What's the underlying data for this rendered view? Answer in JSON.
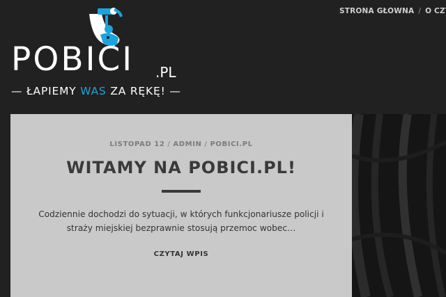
{
  "nav": {
    "items": [
      "STRONA GŁÓWNA",
      "O CZYM"
    ],
    "separator": "/"
  },
  "logo": {
    "word": "POBICI",
    "suffix": ".PL",
    "tagline_dash_left": "—",
    "tagline_pre": "ŁAPIEMY",
    "tagline_highlight": "WAS",
    "tagline_post": "ZA RĘKĘ!",
    "tagline_dash_right": "—",
    "accent_color": "#1aa3dd"
  },
  "post": {
    "date": "LISTOPAD 12",
    "author": "ADMIN",
    "category": "POBICI.PL",
    "meta_separator": "/",
    "title": "WITAMY NA POBICI.PL!",
    "excerpt": "Codziennie dochodzi do sytuacji, w których funkcjonariusze policji i straży miejskiej bezprawnie stosują przemoc wobec…",
    "read_more": "CZYTAJ WPIS"
  },
  "colors": {
    "background": "#212121",
    "card": "#c9c9c9",
    "text_dark": "#3a3a3a"
  }
}
